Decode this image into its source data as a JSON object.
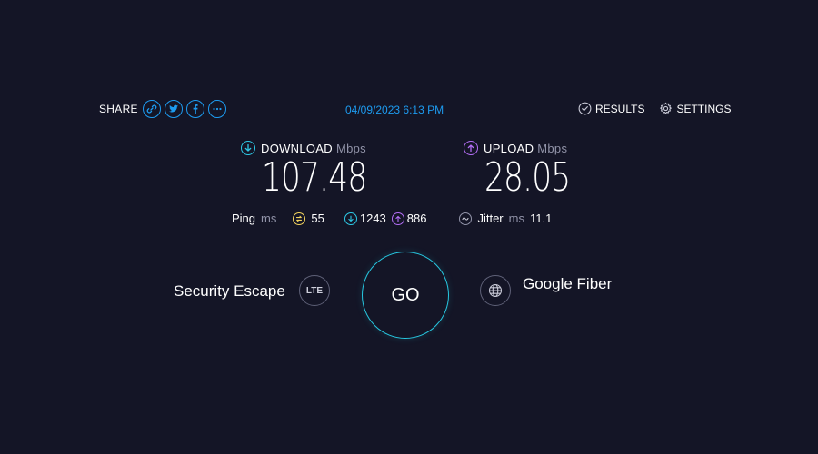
{
  "share": {
    "label": "SHARE",
    "icons": [
      "link-icon",
      "twitter-icon",
      "facebook-icon",
      "more-icon"
    ]
  },
  "datetime": "04/09/2023 6:13 PM",
  "nav": {
    "results_label": "RESULTS",
    "settings_label": "SETTINGS"
  },
  "download": {
    "label": "DOWNLOAD",
    "unit": "Mbps",
    "value": "107.48",
    "color": "#2ec9e6"
  },
  "upload": {
    "label": "UPLOAD",
    "unit": "Mbps",
    "value": "28.05",
    "color": "#b36ef5"
  },
  "ping": {
    "label": "Ping",
    "unit": "ms",
    "idle": "55",
    "download": "1243",
    "upload": "886",
    "idle_color": "#f2d35d"
  },
  "jitter": {
    "label": "Jitter",
    "unit": "ms",
    "value": "11.1"
  },
  "connection": {
    "isp_left": "Security Escape",
    "type_badge": "LTE",
    "go_label": "GO",
    "isp_right": "Google Fiber"
  },
  "colors": {
    "background": "#141526",
    "accent_blue": "#1d9bf0",
    "go_ring": "#27c7e0"
  }
}
